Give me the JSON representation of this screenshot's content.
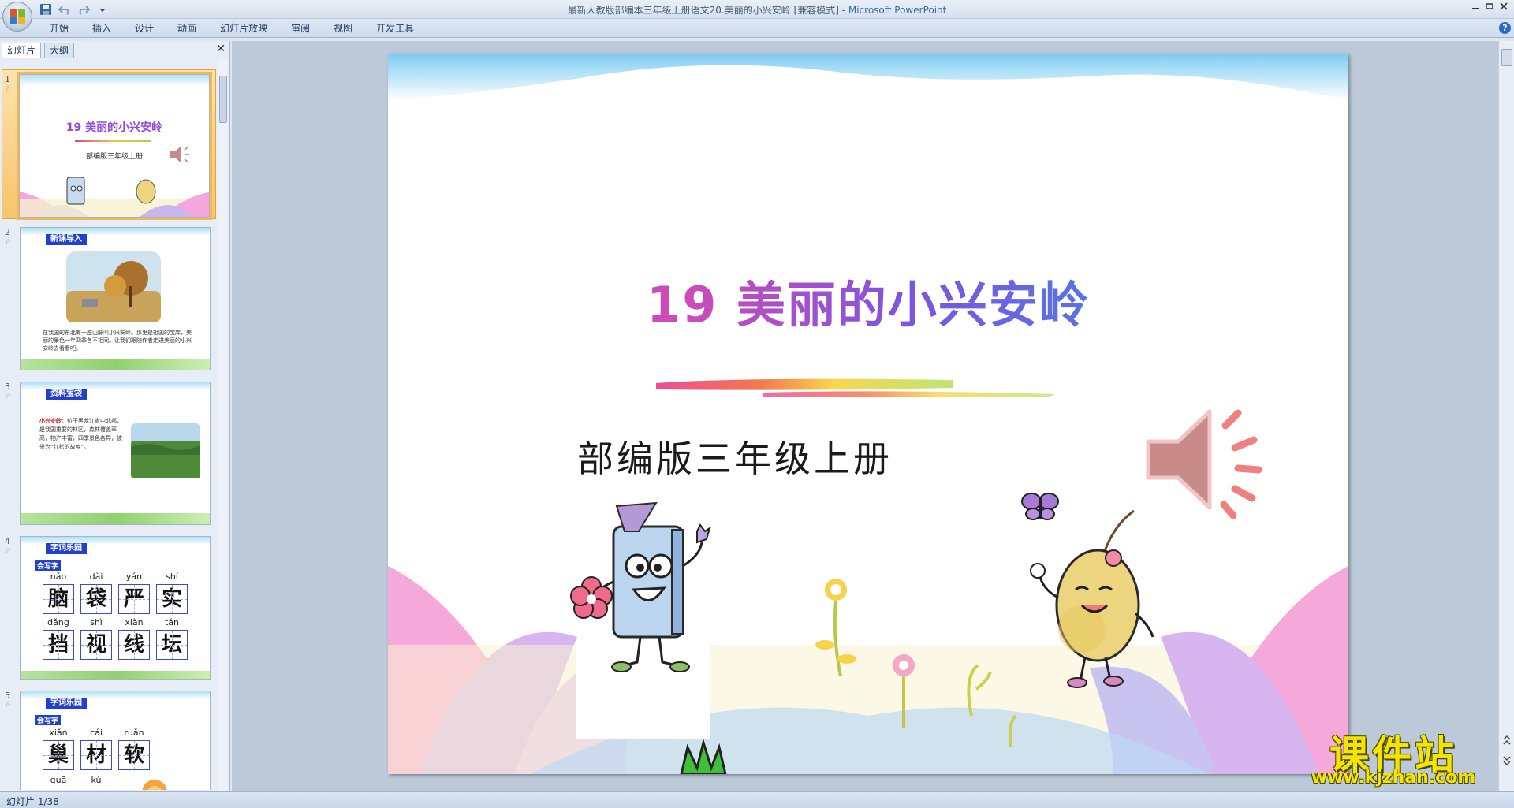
{
  "window": {
    "title": "最新人教版部编本三年级上册语文20.美丽的小兴安岭 [兼容模式]",
    "separator": " - ",
    "app_name": "Microsoft PowerPoint"
  },
  "ribbon": {
    "tabs": [
      "开始",
      "插入",
      "设计",
      "动画",
      "幻灯片放映",
      "审阅",
      "视图",
      "开发工具"
    ]
  },
  "left_pane": {
    "tabs": [
      "幻灯片",
      "大纲"
    ],
    "close_glyph": "✕"
  },
  "thumbnails": [
    {
      "number": "1",
      "title": "19 美丽的小兴安岭",
      "subtitle": "部编版三年级上册"
    },
    {
      "number": "2",
      "header": "新课导入",
      "paragraph": "在我国的东北有一座山脉叫小兴安岭。那里是祖国的宝库，美丽的景色一年四季各不相同。让我们跟随作者走进美丽的小兴安岭去看看吧。"
    },
    {
      "number": "3",
      "header": "资料宝袋",
      "term": "小兴安岭：",
      "paragraph": "位于黑龙江省中北部，是我国重要的林区，森林覆盖率高，物产丰富，四季景色各异，被誉为“红松的故乡”。"
    },
    {
      "number": "4",
      "header": "字词乐园",
      "tag": "会写字",
      "pinyin": [
        "nǎo",
        "dài",
        "yán",
        "shí",
        "dǎng",
        "shì",
        "xiàn",
        "tán"
      ],
      "chars": [
        "脑",
        "袋",
        "严",
        "实",
        "挡",
        "视",
        "线",
        "坛"
      ]
    },
    {
      "number": "5",
      "header": "字词乐园",
      "tag": "会写字",
      "pinyin": [
        "xiǎn",
        "cái",
        "ruǎn",
        "guā",
        "kù"
      ],
      "chars": [
        "巢",
        "材",
        "软"
      ]
    }
  ],
  "slide": {
    "title": "19 美丽的小兴安岭",
    "subtitle": "部编版三年级上册"
  },
  "status": {
    "text": "幻灯片 1/38"
  },
  "watermark": {
    "text": "课件站",
    "url": "www.kjzhan.com"
  },
  "icons": {
    "office_button": "office-logo-icon",
    "save": "save-icon",
    "undo": "undo-icon",
    "redo": "redo-icon",
    "customize": "qat-dropdown-icon",
    "speaker": "speaker-icon",
    "help": "help-icon"
  },
  "colors": {
    "title_gradient": [
      "#8e4bd8",
      "#d04bb6",
      "#4b7fe4"
    ],
    "selection": "#f6b84a",
    "header_blue": "#2241c8",
    "watermark": "#f5e400"
  }
}
